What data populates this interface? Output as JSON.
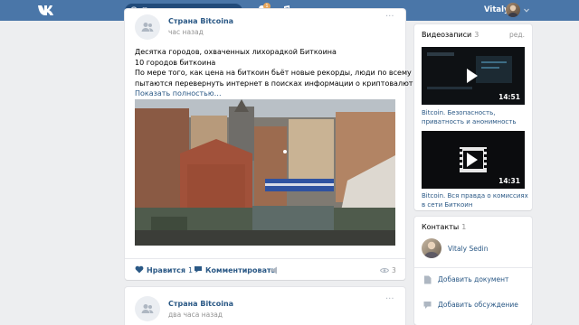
{
  "header": {
    "logo_icon": "vk-logo-icon",
    "search_placeholder": "Поиск",
    "notifications_count": "1",
    "user_name": "Vitaly"
  },
  "feed": {
    "post1": {
      "author": "Страна Bitcoina",
      "time": "час назад",
      "text_lines": [
        "Десятка городов, охваченных лихорадкой Биткоина",
        "10 городов биткоина",
        "По мере того, как цена на биткоин бьёт новые рекорды, люди по всему миру",
        "пытаются перевернуть интернет в поисках информации о криптовалюте."
      ],
      "show_more": "Показать полностью…",
      "like_label": "Нравится",
      "like_count": "1",
      "comment_label": "Комментировать",
      "views": "3"
    },
    "post2": {
      "author": "Страна Bitcoina",
      "time": "два часа назад"
    }
  },
  "sidebar": {
    "videos": {
      "title": "Видеозаписи",
      "count": "3",
      "edit": "ред.",
      "items": [
        {
          "duration": "14:51",
          "title": "Bitcoin. Безопасность, приватность и анонимность"
        },
        {
          "duration": "14:31",
          "title": "Bitcoin. Вся правда о комиссиях в сети Биткоин"
        }
      ]
    },
    "contacts": {
      "title": "Контакты",
      "count": "1",
      "items": [
        {
          "name": "Vitaly Sedin"
        }
      ],
      "add_document": "Добавить документ",
      "add_discussion": "Добавить обсуждение"
    }
  },
  "colors": {
    "header_bg": "#4a76a8",
    "link": "#2a5885",
    "page_bg": "#edeef0",
    "muted": "#939393"
  }
}
